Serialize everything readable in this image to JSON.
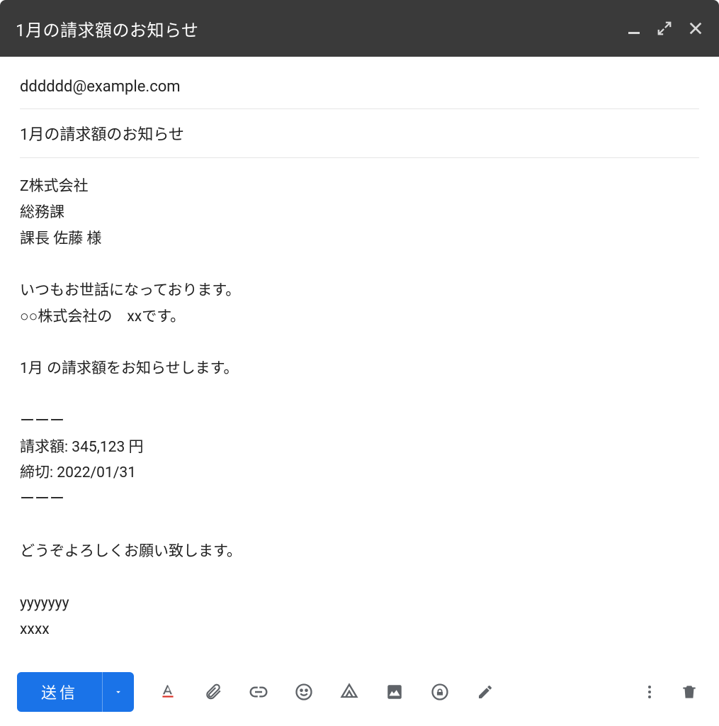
{
  "window": {
    "title": "1月の請求額のお知らせ"
  },
  "to": "dddddd@example.com",
  "subject": "1月の請求額のお知らせ",
  "body": "Z株式会社\n総務課\n課長 佐藤 様\n\nいつもお世話になっております。\n○○株式会社の　xxです。\n\n1月 の請求額をお知らせします。\n\nーーー\n請求額: 345,123 円\n締切: 2022/01/31\nーーー\n\nどうぞよろしくお願い致します。\n\nyyyyyyy\nxxxx",
  "toolbar": {
    "send_label": "送信"
  }
}
